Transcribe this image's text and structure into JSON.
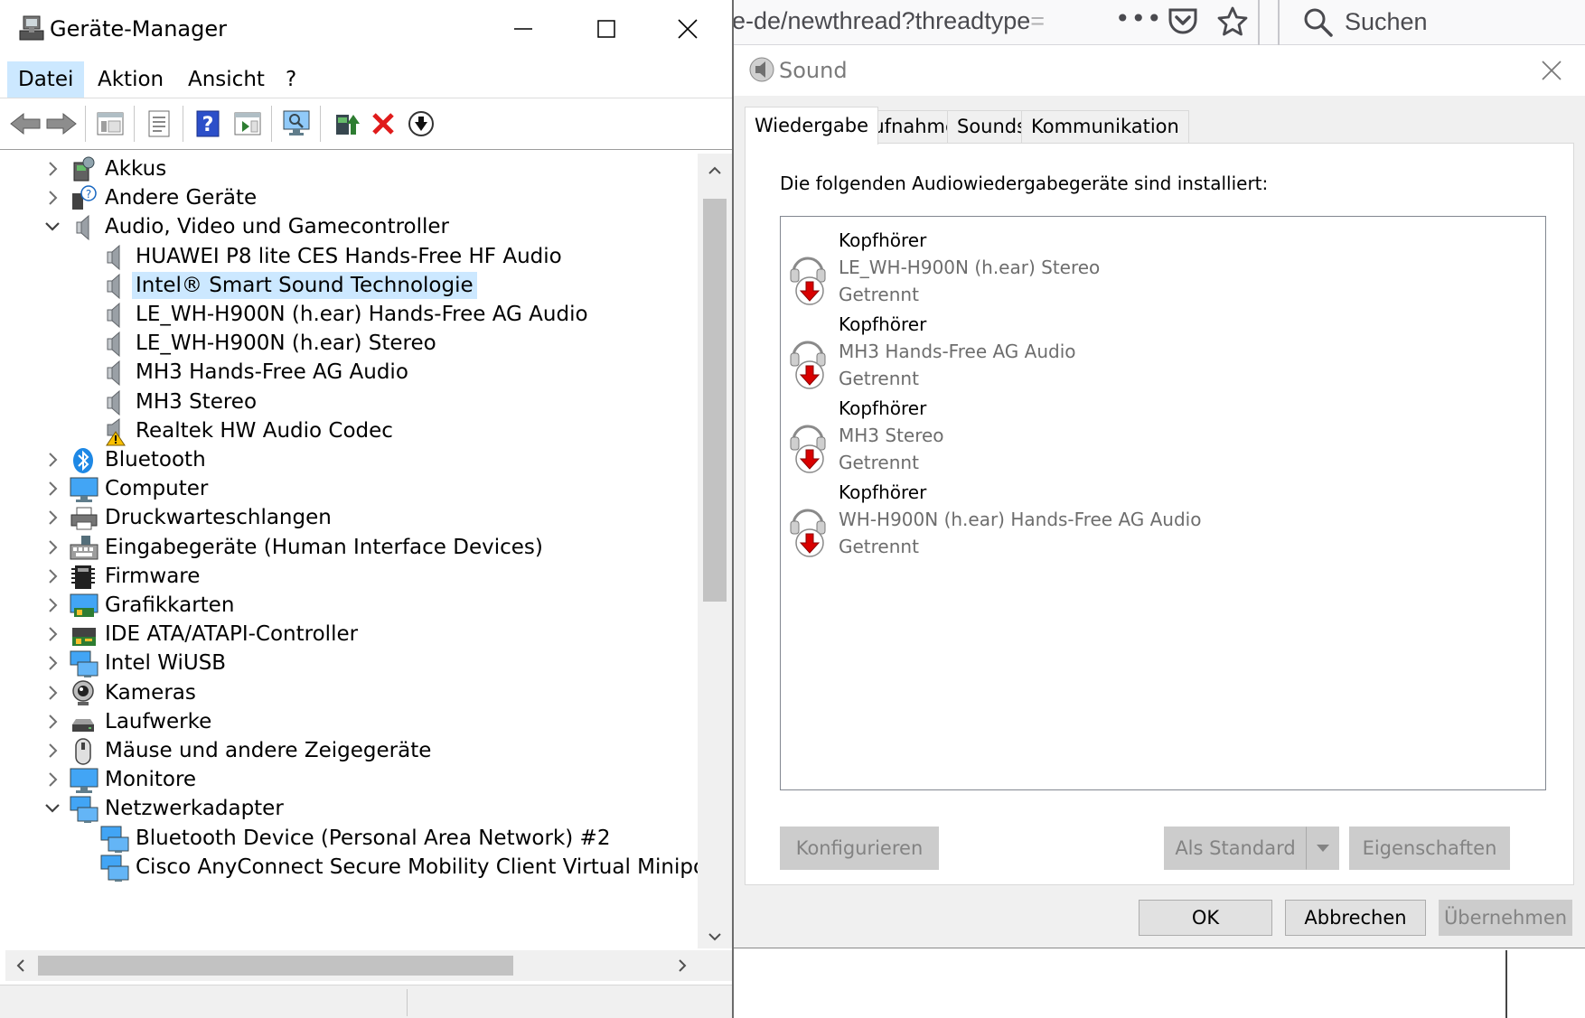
{
  "browser": {
    "url_prefix": "e-de/newthread?threadtype",
    "url_fade": "=",
    "more": "•••",
    "search_placeholder": "Suchen"
  },
  "device_manager": {
    "title": "Geräte-Manager",
    "menu": [
      "Datei",
      "Aktion",
      "Ansicht",
      "?"
    ],
    "tree": [
      {
        "label": "Akkus",
        "level": 0,
        "expanded": false,
        "icon": "battery-icon"
      },
      {
        "label": "Andere Geräte",
        "level": 0,
        "expanded": false,
        "icon": "unknown-device-icon"
      },
      {
        "label": "Audio, Video und Gamecontroller",
        "level": 0,
        "expanded": true,
        "icon": "speaker-icon"
      },
      {
        "label": "HUAWEI P8 lite CES Hands-Free HF Audio",
        "level": 1,
        "icon": "speaker-icon"
      },
      {
        "label": "Intel® Smart Sound Technologie",
        "level": 1,
        "icon": "speaker-icon",
        "selected": true
      },
      {
        "label": "LE_WH-H900N (h.ear) Hands-Free AG Audio",
        "level": 1,
        "icon": "speaker-icon"
      },
      {
        "label": "LE_WH-H900N (h.ear) Stereo",
        "level": 1,
        "icon": "speaker-icon"
      },
      {
        "label": "MH3 Hands-Free AG Audio",
        "level": 1,
        "icon": "speaker-icon"
      },
      {
        "label": "MH3 Stereo",
        "level": 1,
        "icon": "speaker-icon"
      },
      {
        "label": "Realtek HW Audio Codec",
        "level": 1,
        "icon": "speaker-warning-icon"
      },
      {
        "label": "Bluetooth",
        "level": 0,
        "expanded": false,
        "icon": "bluetooth-icon"
      },
      {
        "label": "Computer",
        "level": 0,
        "expanded": false,
        "icon": "monitor-icon"
      },
      {
        "label": "Druckwarteschlangen",
        "level": 0,
        "expanded": false,
        "icon": "printer-icon"
      },
      {
        "label": "Eingabegeräte (Human Interface Devices)",
        "level": 0,
        "expanded": false,
        "icon": "keyboard-icon"
      },
      {
        "label": "Firmware",
        "level": 0,
        "expanded": false,
        "icon": "chip-icon"
      },
      {
        "label": "Grafikkarten",
        "level": 0,
        "expanded": false,
        "icon": "graphics-card-icon"
      },
      {
        "label": "IDE ATA/ATAPI-Controller",
        "level": 0,
        "expanded": false,
        "icon": "controller-icon"
      },
      {
        "label": "Intel WiUSB",
        "level": 0,
        "expanded": false,
        "icon": "network-icon"
      },
      {
        "label": "Kameras",
        "level": 0,
        "expanded": false,
        "icon": "camera-icon"
      },
      {
        "label": "Laufwerke",
        "level": 0,
        "expanded": false,
        "icon": "drive-icon"
      },
      {
        "label": "Mäuse und andere Zeigegeräte",
        "level": 0,
        "expanded": false,
        "icon": "mouse-icon"
      },
      {
        "label": "Monitore",
        "level": 0,
        "expanded": false,
        "icon": "monitor-icon"
      },
      {
        "label": "Netzwerkadapter",
        "level": 0,
        "expanded": true,
        "icon": "network-icon"
      },
      {
        "label": "Bluetooth Device (Personal Area Network) #2",
        "level": 1,
        "icon": "network-icon"
      },
      {
        "label": "Cisco AnyConnect Secure Mobility Client Virtual Miniport A",
        "level": 1,
        "icon": "network-icon"
      }
    ]
  },
  "sound": {
    "title": "Sound",
    "tabs": [
      "Wiedergabe",
      "Aufnahme",
      "Sounds",
      "Kommunikation"
    ],
    "intro": "Die folgenden Audiowiedergabegeräte sind installiert:",
    "devices": [
      {
        "name": "Kopfhörer",
        "desc": "LE_WH-H900N (h.ear) Stereo",
        "status": "Getrennt"
      },
      {
        "name": "Kopfhörer",
        "desc": "MH3 Hands-Free AG Audio",
        "status": "Getrennt"
      },
      {
        "name": "Kopfhörer",
        "desc": "MH3 Stereo",
        "status": "Getrennt"
      },
      {
        "name": "Kopfhörer",
        "desc": "WH-H900N (h.ear) Hands-Free AG Audio",
        "status": "Getrennt"
      }
    ],
    "buttons": {
      "configure": "Konfigurieren",
      "set_default": "Als Standard",
      "properties": "Eigenschaften",
      "ok": "OK",
      "cancel": "Abbrechen",
      "apply": "Übernehmen"
    }
  }
}
